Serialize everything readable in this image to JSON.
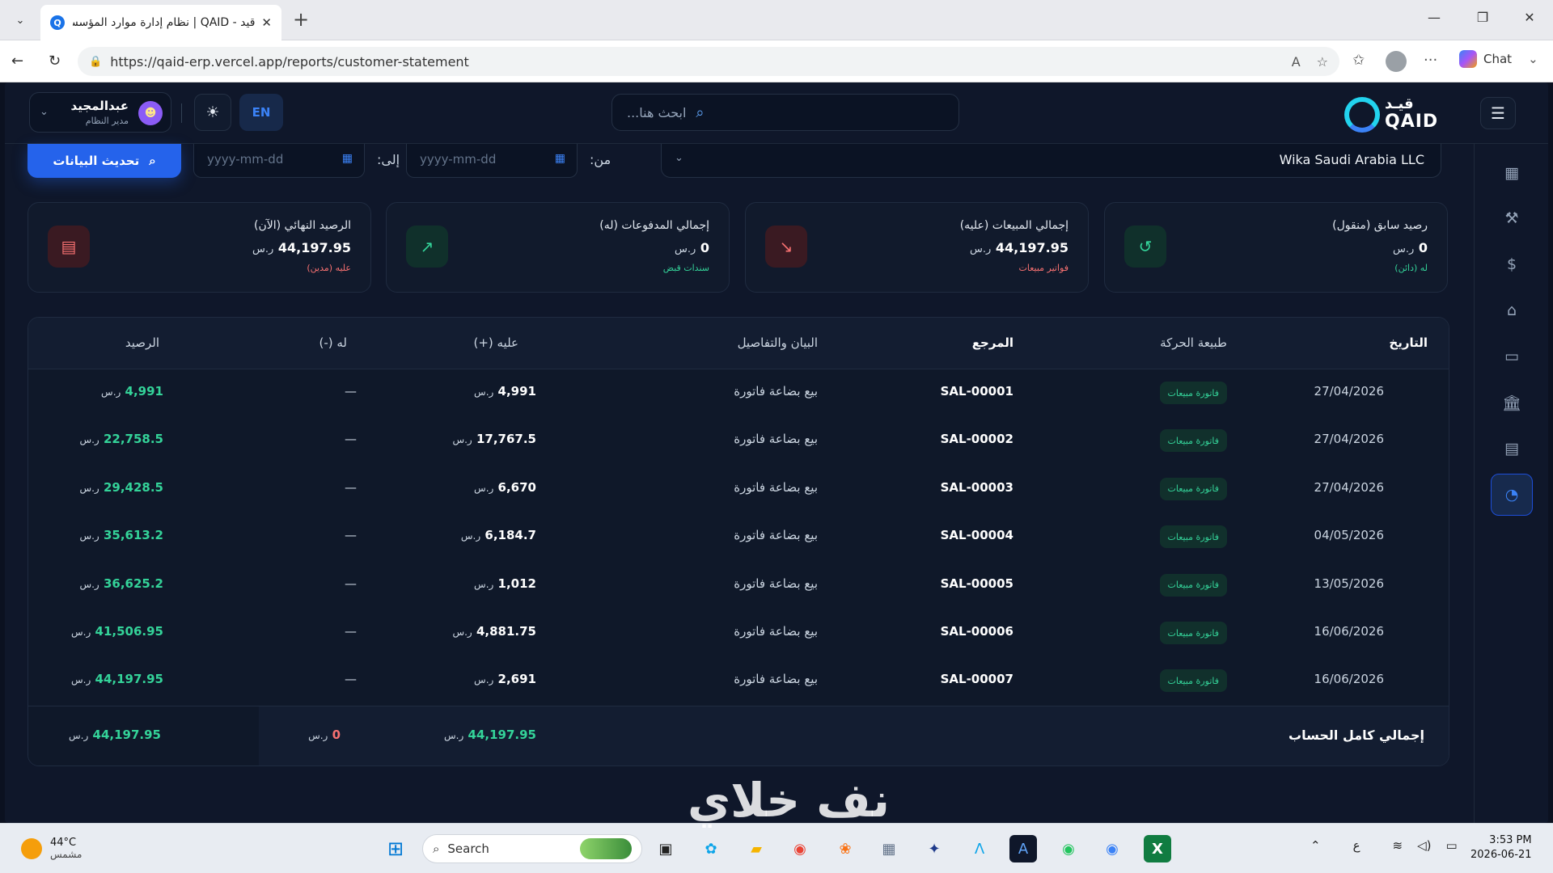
{
  "browser": {
    "tab_title": "قيد - QAID | نظام إدارة موارد المؤسسة",
    "tab_favicon": "Q",
    "url": "https://qaid-erp.vercel.app/reports/customer-statement",
    "chat_label": "Chat"
  },
  "app": {
    "logo_top": "قيـد",
    "logo_bottom": "QAID",
    "search_placeholder": "ابحث هنا...",
    "lang_button": "EN",
    "user_name": "عبدالمجيد",
    "user_role": "مدير النظام"
  },
  "filters": {
    "customer": "Wika Saudi Arabia LLC",
    "from_label": "من:",
    "to_label": "إلى:",
    "date_placeholder": "yyyy-mm-dd",
    "refresh_label": "تحديث البيانات"
  },
  "cards": [
    {
      "title": "رصيد سابق (منقول)",
      "value": "0",
      "unit": "ر.س",
      "sub": "له (دائن)",
      "sub_color": "#34d399",
      "icon": "history-icon",
      "icon_color": "#34d399",
      "icon_bg": "#10302b"
    },
    {
      "title": "إجمالي المبيعات (عليه)",
      "value": "44,197.95",
      "unit": "ر.س",
      "sub": "فواتير مبيعات",
      "sub_color": "#f87171",
      "icon": "trend-down-icon",
      "icon_color": "#f87171",
      "icon_bg": "#3a1a22"
    },
    {
      "title": "إجمالي المدفوعات (له)",
      "value": "0",
      "unit": "ر.س",
      "sub": "سندات قبض",
      "sub_color": "#34d399",
      "icon": "trend-up-icon",
      "icon_color": "#34d399",
      "icon_bg": "#10302b"
    },
    {
      "title": "الرصيد النهائي (الآن)",
      "value": "44,197.95",
      "unit": "ر.س",
      "sub": "عليه (مدين)",
      "sub_color": "#f87171",
      "icon": "document-icon",
      "icon_color": "#f87171",
      "icon_bg": "#3a1a22"
    }
  ],
  "table": {
    "headers": {
      "date": "التاريخ",
      "type": "طبيعة الحركة",
      "ref": "المرجع",
      "desc": "البيان والتفاصيل",
      "debit": "عليه (+)",
      "credit": "له (-)",
      "balance": "الرصيد"
    },
    "rows": [
      {
        "date": "27/04/2026",
        "type": "فاتورة مبيعات",
        "ref": "SAL-00001",
        "desc": "بيع بضاعة فاتورة",
        "debit": "4,991",
        "credit": "—",
        "balance": "4,991"
      },
      {
        "date": "27/04/2026",
        "type": "فاتورة مبيعات",
        "ref": "SAL-00002",
        "desc": "بيع بضاعة فاتورة",
        "debit": "17,767.5",
        "credit": "—",
        "balance": "22,758.5"
      },
      {
        "date": "27/04/2026",
        "type": "فاتورة مبيعات",
        "ref": "SAL-00003",
        "desc": "بيع بضاعة فاتورة",
        "debit": "6,670",
        "credit": "—",
        "balance": "29,428.5"
      },
      {
        "date": "04/05/2026",
        "type": "فاتورة مبيعات",
        "ref": "SAL-00004",
        "desc": "بيع بضاعة فاتورة",
        "debit": "6,184.7",
        "credit": "—",
        "balance": "35,613.2"
      },
      {
        "date": "13/05/2026",
        "type": "فاتورة مبيعات",
        "ref": "SAL-00005",
        "desc": "بيع بضاعة فاتورة",
        "debit": "1,012",
        "credit": "—",
        "balance": "36,625.2"
      },
      {
        "date": "16/06/2026",
        "type": "فاتورة مبيعات",
        "ref": "SAL-00006",
        "desc": "بيع بضاعة فاتورة",
        "debit": "4,881.75",
        "credit": "—",
        "balance": "41,506.95"
      },
      {
        "date": "16/06/2026",
        "type": "فاتورة مبيعات",
        "ref": "SAL-00007",
        "desc": "بيع بضاعة فاتورة",
        "debit": "2,691",
        "credit": "—",
        "balance": "44,197.95"
      }
    ],
    "currency": "ر.س",
    "footer": {
      "label": "إجمالي كامل الحساب",
      "debit": "44,197.95",
      "credit": "0",
      "balance": "44,197.95"
    }
  },
  "watermark": "نف خلاي",
  "taskbar": {
    "temp": "44°C",
    "weather_desc": "مشمس",
    "search_label": "Search",
    "lang_indicator": "ع",
    "time": "3:53 PM",
    "date": "2026-06-21"
  }
}
